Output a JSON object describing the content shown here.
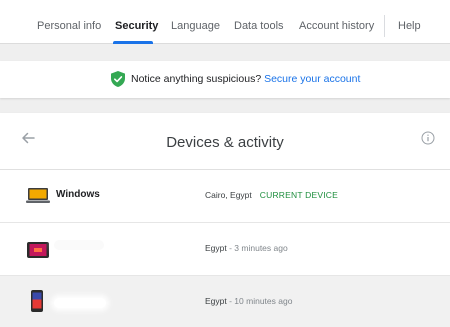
{
  "nav": {
    "tabs": [
      {
        "label": "Personal info",
        "active": false
      },
      {
        "label": "Security",
        "active": true
      },
      {
        "label": "Language",
        "active": false
      },
      {
        "label": "Data tools",
        "active": false
      },
      {
        "label": "Account history",
        "active": false
      },
      {
        "label": "Help",
        "active": false
      }
    ]
  },
  "notice": {
    "icon": "shield-check-icon",
    "text": "Notice anything suspicious? ",
    "link": "Secure your account"
  },
  "card": {
    "title": "Devices & activity",
    "back_icon": "back-arrow-icon",
    "info_icon": "info-icon",
    "devices": [
      {
        "icon": "laptop-icon",
        "name": "Windows",
        "location": "Cairo, Egypt",
        "time": "",
        "badge": "CURRENT DEVICE"
      },
      {
        "icon": "tablet-icon",
        "name": "",
        "location": "Egypt",
        "time": " - 3 minutes ago",
        "badge": ""
      },
      {
        "icon": "phone-icon",
        "name": "",
        "location": "Egypt",
        "time": " - 10 minutes ago",
        "badge": ""
      }
    ]
  },
  "colors": {
    "accent": "#1a73e8",
    "current_device": "#1e8e3e",
    "shield": "#34a853"
  }
}
